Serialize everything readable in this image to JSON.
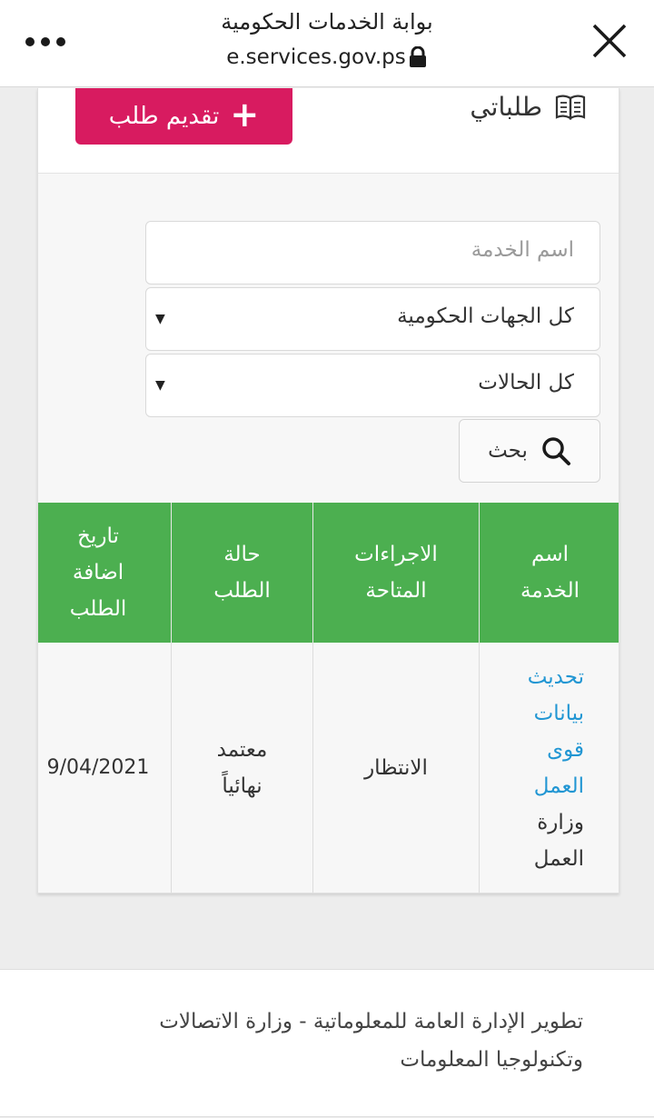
{
  "browser": {
    "title": "بوابة الخدمات الحكومية",
    "url": "e.services.gov.ps"
  },
  "header": {
    "my_requests_label": "طلباتي",
    "new_request_label": "تقديم طلب"
  },
  "filters": {
    "service_name_placeholder": "اسم الخدمة",
    "agency_select": "كل الجهات الحكومية",
    "status_select": "كل الحالات",
    "search_label": "بحث"
  },
  "table": {
    "headers": {
      "service_name": [
        "اسم",
        "الخدمة"
      ],
      "actions": [
        "الاجراءات",
        "المتاحة"
      ],
      "status": [
        "حالة",
        "الطلب"
      ],
      "date": [
        "تاريخ",
        "اضافة",
        "الطلب"
      ]
    },
    "rows": [
      {
        "service_link": [
          "تحديث",
          "بيانات",
          "قوى",
          "العمل"
        ],
        "ministry": [
          "وزارة",
          "العمل"
        ],
        "actions": "الانتظار",
        "status": [
          "معتمد",
          "نهائياً"
        ],
        "date": "9/04/2021"
      }
    ]
  },
  "footer": {
    "line1": "تطوير الإدارة العامة للمعلوماتية - وزارة الاتصالات",
    "line2": "وتكنولوجيا المعلومات"
  },
  "colors": {
    "primary_button": "#d81b60",
    "table_header": "#4caf50",
    "link": "#2196d3"
  },
  "icons": [
    "more-icon",
    "close-icon",
    "lock-icon",
    "book-icon",
    "plus-icon",
    "search-icon",
    "caret-down-icon"
  ]
}
